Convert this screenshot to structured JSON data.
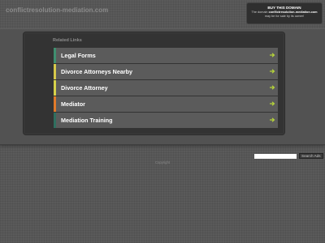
{
  "header": {
    "domain": "conflictresolution-mediation.com"
  },
  "buy_box": {
    "heading": "BUY THIS DOMAIN",
    "text_pre": "The domain",
    "text_domain": "conflictresolution-mediation.com",
    "text_post": "may be for sale by its owner!"
  },
  "related": {
    "heading": "Related Links",
    "items": [
      {
        "label": "Legal Forms",
        "accent": "#3f8f6f"
      },
      {
        "label": "Divorce Attorneys Nearby",
        "accent": "#d6c84a"
      },
      {
        "label": "Divorce Attorney",
        "accent": "#d6d24a"
      },
      {
        "label": "Mediator",
        "accent": "#e07a2a"
      },
      {
        "label": "Mediation Training",
        "accent": "#2f6f5f"
      }
    ],
    "arrow_color": "#b5d33a"
  },
  "footer": {
    "search_placeholder": "",
    "search_button": "Search Ads",
    "copyright": "Copyright"
  }
}
